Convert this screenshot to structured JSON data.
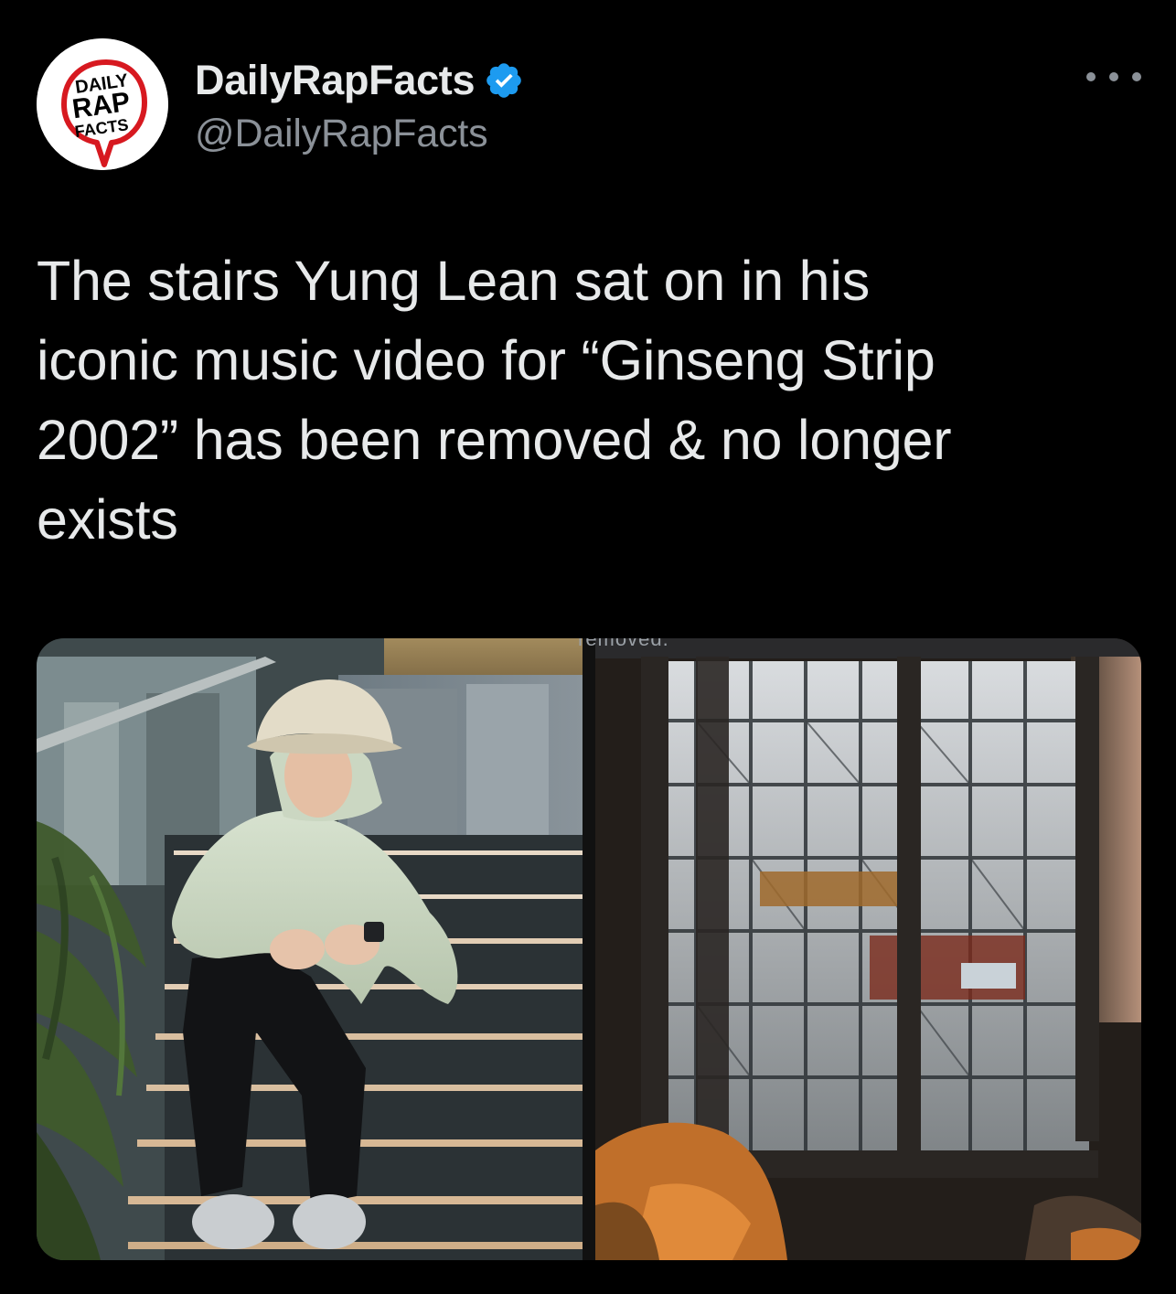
{
  "tweet": {
    "author": {
      "display_name": "DailyRapFacts",
      "handle": "@DailyRapFacts",
      "verified": true,
      "avatar_icon": "daily-rap-facts-logo",
      "avatar_text": [
        "DAILY",
        "RAP",
        "FACTS"
      ]
    },
    "more_icon": "ellipsis-icon",
    "text_lines": [
      "The stairs Yung Lean sat on in his",
      "iconic music video for “Ginseng Strip",
      "2002” has been removed & no longer",
      "exists"
    ],
    "media": {
      "left_photo_icon": "photo-man-on-stairs",
      "right_photo_icon": "photo-scaffolding-window",
      "right_photo_caption_fragment": "removed."
    }
  },
  "colors": {
    "background": "#000000",
    "text_primary": "#e7e9ea",
    "text_secondary": "#8b9198",
    "verified_blue": "#1d9bf0",
    "logo_red": "#d71920"
  }
}
